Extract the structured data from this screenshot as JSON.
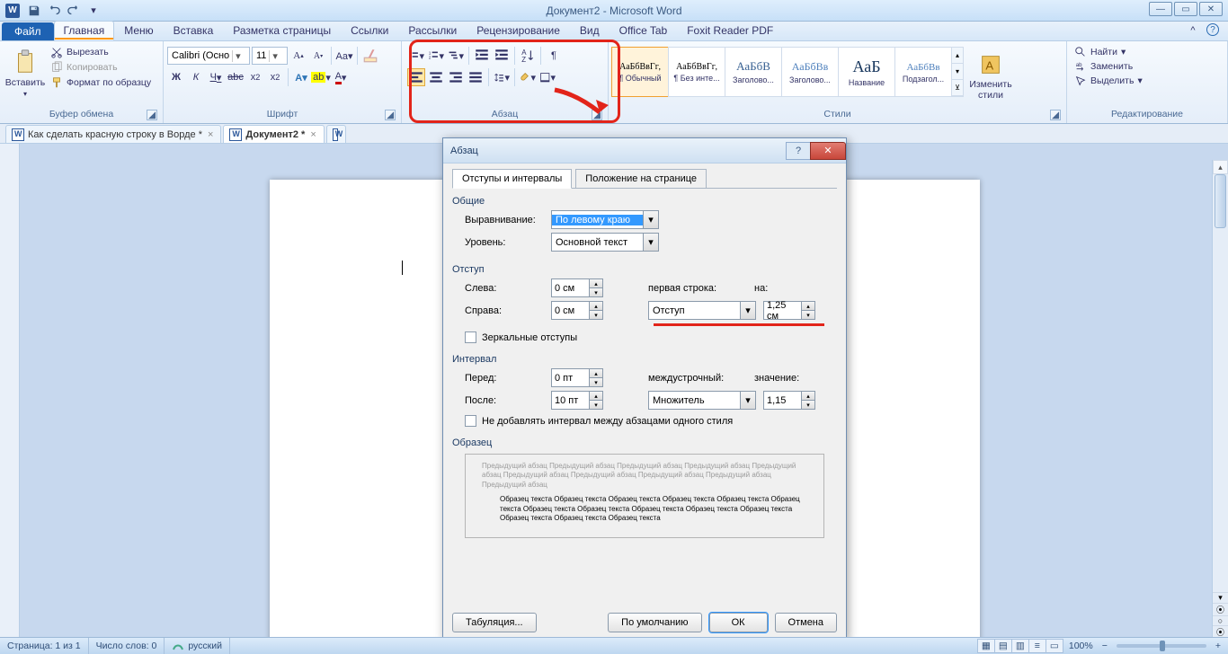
{
  "title": "Документ2  -  Microsoft Word",
  "tabs": {
    "file": "Файл",
    "home": "Главная",
    "menu": "Меню",
    "insert": "Вставка",
    "layout": "Разметка страницы",
    "references": "Ссылки",
    "mailings": "Рассылки",
    "review": "Рецензирование",
    "view": "Вид",
    "officetab": "Office Tab",
    "foxit": "Foxit Reader PDF"
  },
  "ribbon": {
    "clipboard": {
      "paste": "Вставить",
      "cut": "Вырезать",
      "copy": "Копировать",
      "formatPainter": "Формат по образцу",
      "label": "Буфер обмена"
    },
    "font": {
      "label": "Шрифт",
      "family": "Calibri (Осно",
      "size": "11",
      "buttons": {
        "bold": "Ж",
        "italic": "К",
        "underline": "Ч",
        "strike": "abc",
        "sub": "x₂",
        "sup": "x²"
      }
    },
    "paragraph": {
      "label": "Абзац"
    },
    "styles": {
      "label": "Стили",
      "items": [
        {
          "preview": "АаБбВвГг,",
          "name": "¶ Обычный",
          "size": "10px",
          "color": "#000"
        },
        {
          "preview": "АаБбВвГг,",
          "name": "¶ Без инте...",
          "size": "10px",
          "color": "#000"
        },
        {
          "preview": "АаБбВ",
          "name": "Заголово...",
          "size": "13px",
          "color": "#365f91"
        },
        {
          "preview": "АаБбВв",
          "name": "Заголово...",
          "size": "12px",
          "color": "#4f81bd"
        },
        {
          "preview": "АаБ",
          "name": "Название",
          "size": "18px",
          "color": "#17365d"
        },
        {
          "preview": "АаБбВв",
          "name": "Подзагол...",
          "size": "11px",
          "color": "#4f81bd"
        }
      ],
      "changeStyles": "Изменить\nстили"
    },
    "editing": {
      "label": "Редактирование",
      "find": "Найти",
      "replace": "Заменить",
      "select": "Выделить"
    }
  },
  "docTabs": {
    "tab1": "Как сделать красную строку в Ворде *",
    "tab2": "Документ2 *"
  },
  "dialog": {
    "title": "Абзац",
    "tab1": "Отступы и интервалы",
    "tab2": "Положение на странице",
    "general": "Общие",
    "alignment": "Выравнивание:",
    "alignmentVal": "По левому краю",
    "level": "Уровень:",
    "levelVal": "Основной текст",
    "indent": "Отступ",
    "left": "Слева:",
    "leftVal": "0 см",
    "right": "Справа:",
    "rightVal": "0 см",
    "firstLine": "первая строка:",
    "by": "на:",
    "firstLineVal": "Отступ",
    "byVal": "1,25 см",
    "mirror": "Зеркальные отступы",
    "spacing": "Интервал",
    "before": "Перед:",
    "beforeVal": "0 пт",
    "after": "После:",
    "afterVal": "10 пт",
    "lineSpacing": "междустрочный:",
    "at": "значение:",
    "lineSpacingVal": "Множитель",
    "atVal": "1,15",
    "dontAdd": "Не добавлять интервал между абзацами одного стиля",
    "preview": "Образец",
    "previewText1": "Предыдущий абзац Предыдущий абзац Предыдущий абзац Предыдущий абзац Предыдущий абзац Предыдущий абзац Предыдущий абзац Предыдущий абзац Предыдущий абзац Предыдущий абзац",
    "previewText2": "Образец текста Образец текста Образец текста Образец текста Образец текста Образец текста Образец текста Образец текста Образец текста Образец текста Образец текста Образец текста Образец текста Образец текста",
    "tabsBtn": "Табуляция...",
    "defaultBtn": "По умолчанию",
    "ok": "ОК",
    "cancel": "Отмена"
  },
  "statusbar": {
    "page": "Страница: 1 из 1",
    "words": "Число слов: 0",
    "lang": "русский",
    "zoom": "100%"
  }
}
